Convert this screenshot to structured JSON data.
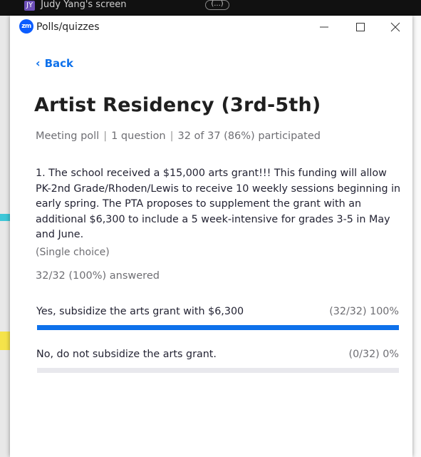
{
  "background": {
    "share_avatar": "JY",
    "share_label": "Judy Yang's screen",
    "more_label": "(...)"
  },
  "window": {
    "logo_text": "zm",
    "title": "Polls/quizzes",
    "controls": [
      "minimize-icon",
      "maximize-icon",
      "close-icon"
    ]
  },
  "back_label": "Back",
  "poll": {
    "title": "Artist Residency (3rd-5th)",
    "meta": {
      "type": "Meeting poll",
      "questions": "1 question",
      "participation": "32 of 37 (86%) participated"
    },
    "question": {
      "text": "1. The school received a $15,000 arts grant!!! This funding will allow PK-2nd Grade/Rhoden/Lewis to receive 10 weekly sessions beginning in early spring. The PTA proposes to supplement the grant with an additional $6,300 to include a 5 week-intensive for grades 3-5 in May and June.",
      "type_label": "(Single choice)",
      "answered": "32/32 (100%) answered"
    },
    "options": [
      {
        "label": "Yes, subsidize the arts grant with $6,300",
        "stat": "(32/32) 100%",
        "fraction": 1.0
      },
      {
        "label": "No, do not subsidize the arts grant.",
        "stat": "(0/32) 0%",
        "fraction": 0.0
      }
    ]
  },
  "colors": {
    "accent": "#0e71eb",
    "brand": "#0b5cff",
    "track": "#e8e8ed"
  }
}
